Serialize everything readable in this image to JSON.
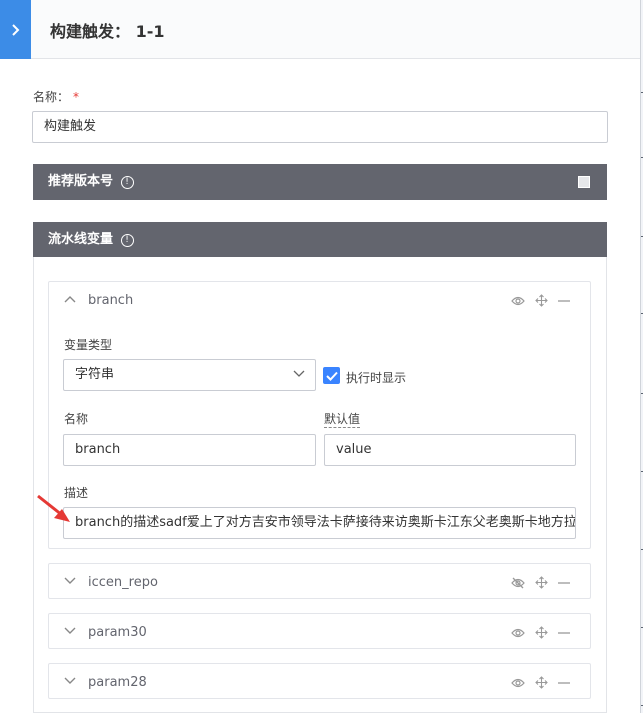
{
  "header": {
    "title": "构建触发： 1-1",
    "collapse_icon": "chevron-right-icon",
    "accent": "#3c8ce7"
  },
  "form": {
    "name_label": "名称：",
    "required_mark": "*",
    "name_value": "构建触发"
  },
  "sections": {
    "recommend_version": {
      "title": "推荐版本号",
      "checked": false
    },
    "pipeline_vars": {
      "title": "流水线变量"
    },
    "bar_color": "#63656e"
  },
  "variables": [
    {
      "name": "branch",
      "expanded": true,
      "visible": true,
      "type_label": "变量类型",
      "type_value": "字符串",
      "show_at_run_label": "执行时显示",
      "show_at_run": true,
      "name_label": "名称",
      "name_value": "branch",
      "default_label": "默认值",
      "default_value": "value",
      "desc_label": "描述",
      "desc_value": "branch的描述sadf爱上了对方吉安市领导法卡萨接待来访奥斯卡江东父老奥斯卡地方拉斯柯达"
    },
    {
      "name": "iccen_repo",
      "expanded": false,
      "visible": false
    },
    {
      "name": "param30",
      "expanded": false,
      "visible": true
    },
    {
      "name": "param28",
      "expanded": false,
      "visible": true
    }
  ],
  "icons": {
    "visible": "eye-icon",
    "hidden": "eye-off-icon",
    "drag": "move-icon",
    "remove": "minus-icon",
    "info": "info-icon"
  },
  "colors": {
    "checkbox_blue": "#3a84ff",
    "annotation_red": "#e53935"
  }
}
